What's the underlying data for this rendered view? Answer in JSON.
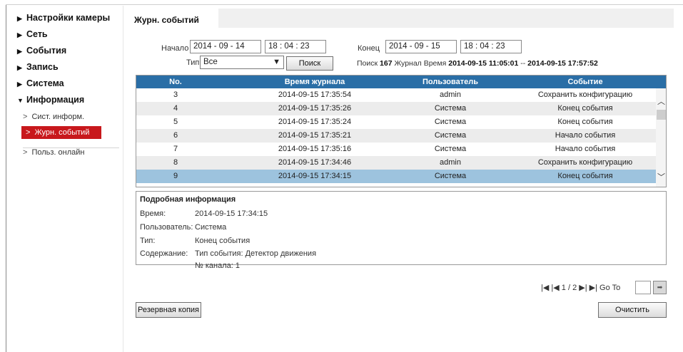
{
  "sidebar": {
    "items": [
      {
        "label": "Настройки камеры",
        "arrow": "▶"
      },
      {
        "label": "Сеть",
        "arrow": "▶"
      },
      {
        "label": "События",
        "arrow": "▶"
      },
      {
        "label": "Запись",
        "arrow": "▶"
      },
      {
        "label": "Система",
        "arrow": "▶"
      },
      {
        "label": "Информация",
        "arrow": "▼"
      }
    ],
    "subitems": [
      {
        "label": "Сист. информ.",
        "chev": ">"
      },
      {
        "label": "Журн. событий",
        "chev": ">"
      },
      {
        "label": "Польз. онлайн",
        "chev": ">"
      }
    ],
    "active_color": "#c8181c"
  },
  "main": {
    "tab": "Журн. событий",
    "filter": {
      "start_label": "Начало",
      "start_date": "2014 - 09 - 14",
      "start_time": "18 : 04 : 23",
      "end_label": "Конец",
      "end_date": "2014 - 09 - 15",
      "end_time": "18 : 04 : 23",
      "type_label": "Тип",
      "type_value": "Все",
      "search_button": "Поиск"
    },
    "summary": {
      "prefix": "Поиск",
      "count": "167",
      "middle": "Журнал Время",
      "from": "2014-09-15 11:05:01",
      "sep": "--",
      "to": "2014-09-15 17:57:52"
    },
    "table": {
      "header_color": "#2a6ea6",
      "selected_color": "#9dc3de",
      "columns": [
        "No.",
        "Время журнала",
        "Пользователь",
        "Событие"
      ],
      "rows": [
        {
          "no": "3",
          "time": "2014-09-15 17:35:54",
          "user": "admin",
          "event": "Сохранить конфигурацию"
        },
        {
          "no": "4",
          "time": "2014-09-15 17:35:26",
          "user": "Система",
          "event": "Конец события"
        },
        {
          "no": "5",
          "time": "2014-09-15 17:35:24",
          "user": "Система",
          "event": "Конец события"
        },
        {
          "no": "6",
          "time": "2014-09-15 17:35:21",
          "user": "Система",
          "event": "Начало события"
        },
        {
          "no": "7",
          "time": "2014-09-15 17:35:16",
          "user": "Система",
          "event": "Начало события"
        },
        {
          "no": "8",
          "time": "2014-09-15 17:34:46",
          "user": "admin",
          "event": "Сохранить конфигурацию"
        },
        {
          "no": "9",
          "time": "2014-09-15 17:34:15",
          "user": "Система",
          "event": "Конец события"
        }
      ],
      "selected_no": "9"
    },
    "detail": {
      "title": "Подробная информация",
      "time_label": "Время:",
      "time_value": "2014-09-15 17:34:15",
      "user_label": "Пользователь:",
      "user_value": "Система",
      "type_label": "Тип:",
      "type_value": "Конец события",
      "content_label": "Содержание:",
      "content_value": "Тип события: Детектор движения",
      "channel_value": "№ канала: 1"
    },
    "pager": {
      "first": "|◀",
      "prev": "|◀",
      "page": "1 / 2",
      "next": "▶|",
      "last": "▶|",
      "goto_label": "Go To",
      "goto_value": "",
      "goto_icon": "➡"
    },
    "buttons": {
      "backup": "Резервная копия",
      "clear": "Очистить"
    }
  }
}
